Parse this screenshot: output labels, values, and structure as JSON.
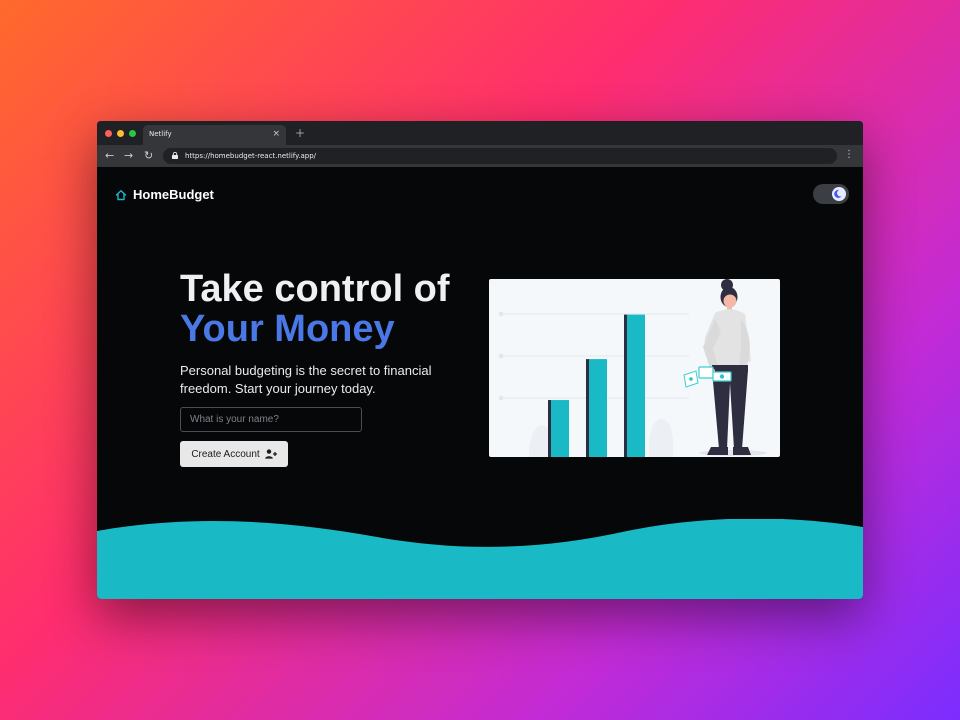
{
  "browser": {
    "tab_title": "Netlify",
    "tab_close": "×",
    "new_tab": "+",
    "back": "←",
    "forward": "→",
    "reload": "↻",
    "url": "https://homebudget-react.netlify.app/",
    "menu": "⋮"
  },
  "app": {
    "brand": "HomeBudget",
    "theme_icon": "moon-icon",
    "hero": {
      "title_line1": "Take control of",
      "title_line2": "Your Money",
      "tagline": "Personal budgeting is the secret to financial freedom. Start your journey today."
    },
    "form": {
      "name_placeholder": "What is your name?",
      "name_value": "",
      "submit_label": "Create Account"
    },
    "chart_bars": [
      0.32,
      0.55,
      0.8
    ]
  },
  "colors": {
    "accent": "#1ab9c6",
    "title_blue": "#4a78e6",
    "background": "#060708"
  }
}
